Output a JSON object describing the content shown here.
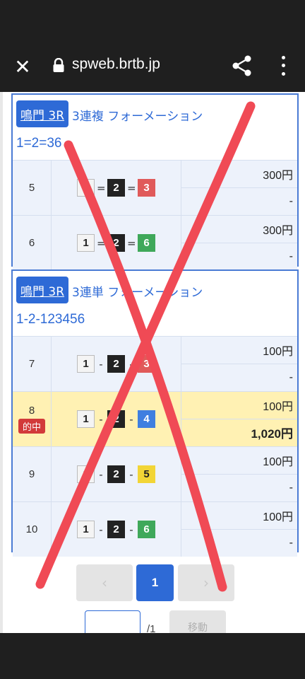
{
  "browser": {
    "url": "spweb.brtb.jp",
    "close_icon": "close-icon",
    "lock_icon": "lock-icon",
    "share_icon": "share-icon",
    "menu_icon": "more-vert-icon"
  },
  "cards": [
    {
      "venue": "鳴門 3R",
      "bet_type": "3連複 フォーメーション",
      "combination": "1=2=36",
      "rows": [
        {
          "no": "5",
          "boats": [
            "1",
            "2",
            "3"
          ],
          "sep": "=",
          "stake": "300円",
          "payout": "-",
          "hit": false
        },
        {
          "no": "6",
          "boats": [
            "1",
            "2",
            "6"
          ],
          "sep": "=",
          "stake": "300円",
          "payout": "-",
          "hit": false
        }
      ]
    },
    {
      "venue": "鳴門 3R",
      "bet_type": "3連単 フォーメーション",
      "combination": "1-2-123456",
      "rows": [
        {
          "no": "7",
          "boats": [
            "1",
            "2",
            "3"
          ],
          "sep": "-",
          "stake": "100円",
          "payout": "-",
          "hit": false
        },
        {
          "no": "8",
          "boats": [
            "1",
            "2",
            "4"
          ],
          "sep": "-",
          "stake": "100円",
          "payout": "1,020円",
          "hit": true,
          "hit_label": "的中"
        },
        {
          "no": "9",
          "boats": [
            "1",
            "2",
            "5"
          ],
          "sep": "-",
          "stake": "100円",
          "payout": "-",
          "hit": false
        },
        {
          "no": "10",
          "boats": [
            "1",
            "2",
            "6"
          ],
          "sep": "-",
          "stake": "100円",
          "payout": "-",
          "hit": false
        }
      ]
    }
  ],
  "pager": {
    "prev": "‹",
    "current": "1",
    "next": "›"
  },
  "jump": {
    "value": "",
    "total": "/1",
    "go_label": "移動"
  },
  "colors": {
    "accent": "#2e6ad6",
    "hit_bg": "#fff1b3",
    "cross_mark": "#f04a55"
  }
}
